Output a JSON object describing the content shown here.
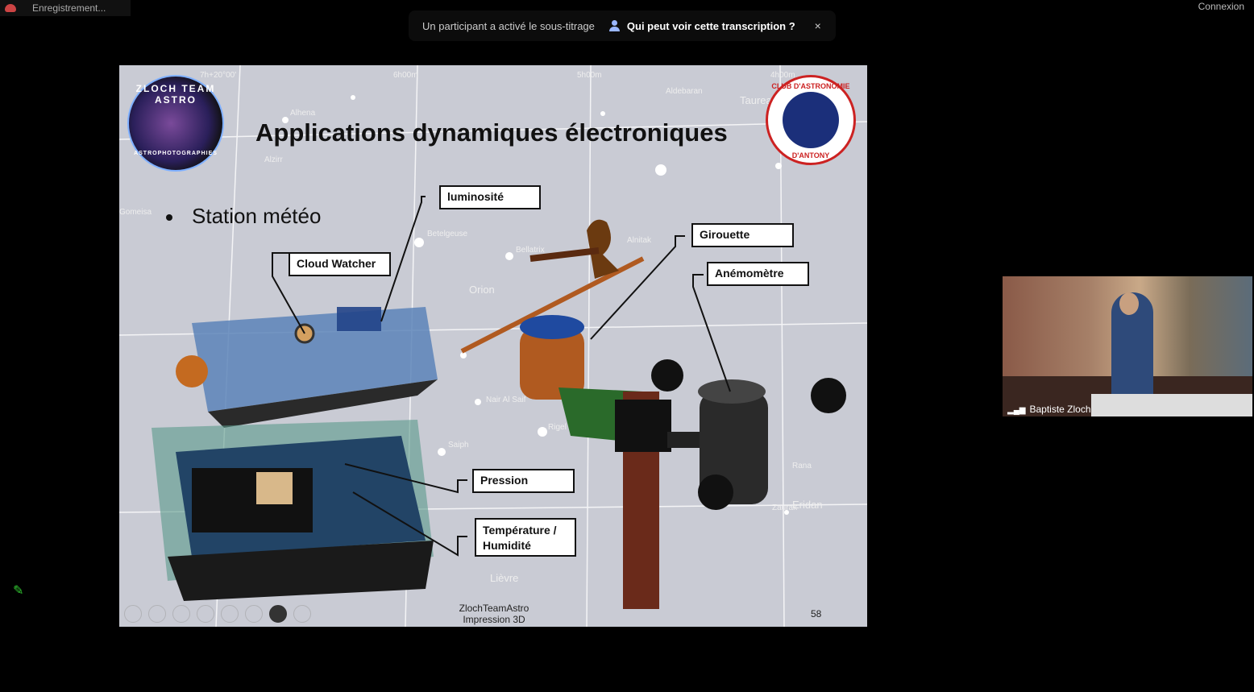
{
  "topbar": {
    "recording_label": "Enregistrement...",
    "connexion_label": "Connexion"
  },
  "notification": {
    "message": "Un participant a activé le sous-titrage",
    "who_can_see": "Qui peut voir cette transcription ?",
    "close_icon": "×"
  },
  "slide": {
    "title": "Applications dynamiques électroniques",
    "bullet": "Station météo",
    "labels": {
      "luminosite": "luminosité",
      "cloud_watcher": "Cloud Watcher",
      "girouette": "Girouette",
      "anemometre": "Anémomètre",
      "pression": "Pression",
      "temperature_line1": "Température /",
      "temperature_line2": "Humidité"
    },
    "logo_left": {
      "text": "ZLOCH TEAM ASTRO",
      "sub": "ASTROPHOTOGRAPHIES"
    },
    "logo_right": {
      "top": "CLUB D'ASTRONOMIE",
      "bottom": "D'ANTONY"
    },
    "star_labels": [
      "Orion",
      "Bellatrix",
      "Betelgeuse",
      "Rigel",
      "Saiph",
      "Eridan",
      "Lièvre",
      "Taureau",
      "Aldebaran",
      "Alnitak",
      "Nair Al Saif",
      "Zaurak",
      "Rana",
      "Alzirr",
      "Gomeisa",
      "7h+20°00'",
      "6h00m",
      "5h00m",
      "4h00m",
      "Alhena"
    ],
    "footer_line1": "ZlochTeamAstro",
    "footer_line2": "Impression 3D",
    "page_number": "58"
  },
  "video": {
    "participant_name": "Baptiste Zloch",
    "signal_icon": "signal-bars-icon"
  },
  "colors": {
    "notif_accent": "#9ab6ff",
    "pen": "#33cc33",
    "logo_ring": "#cc2222"
  }
}
